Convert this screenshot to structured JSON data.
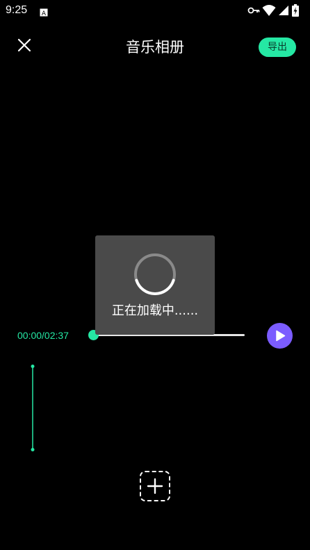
{
  "status_bar": {
    "time": "9:25",
    "icons": [
      "app-notification-icon",
      "key-icon",
      "wifi-icon",
      "signal-icon",
      "battery-charging-icon"
    ]
  },
  "header": {
    "title": "音乐相册",
    "export_label": "导出",
    "close_icon": "close-icon"
  },
  "player": {
    "time_readout": "00:00/02:37",
    "progress": 0,
    "play_icon": "play-icon"
  },
  "add_button": {
    "icon": "plus-icon"
  },
  "loading_dialog": {
    "text": "正在加载中......"
  },
  "colors": {
    "accent": "#25e8a4",
    "play_button": "#7b5cff",
    "dialog_bg": "#4a4a4a",
    "background": "#000000"
  }
}
